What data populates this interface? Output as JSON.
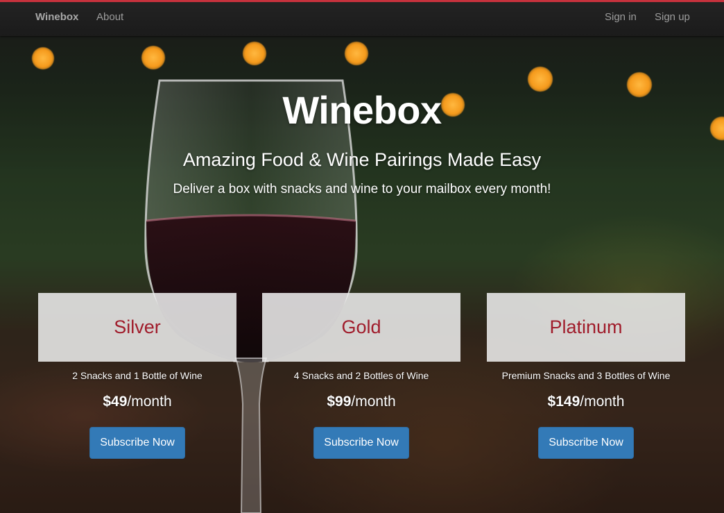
{
  "navbar": {
    "brand": "Winebox",
    "about": "About",
    "sign_in": "Sign in",
    "sign_up": "Sign up",
    "accent_color": "#c7323d"
  },
  "hero": {
    "title": "Winebox",
    "subtitle": "Amazing Food & Wine Pairings Made Easy",
    "tagline": "Deliver a box with snacks and wine to your mailbox every month!"
  },
  "plans": [
    {
      "name": "Silver",
      "description": "2 Snacks and 1 Bottle of Wine",
      "price": "$49",
      "period": "/month",
      "button": "Subscribe Now"
    },
    {
      "name": "Gold",
      "description": "4 Snacks and 2 Bottles of Wine",
      "price": "$99",
      "period": "/month",
      "button": "Subscribe Now"
    },
    {
      "name": "Platinum",
      "description": "Premium Snacks and 3 Bottles of Wine",
      "price": "$149",
      "period": "/month",
      "button": "Subscribe Now"
    }
  ],
  "colors": {
    "plan_name": "#a01c2b",
    "button": "#337ab7"
  }
}
